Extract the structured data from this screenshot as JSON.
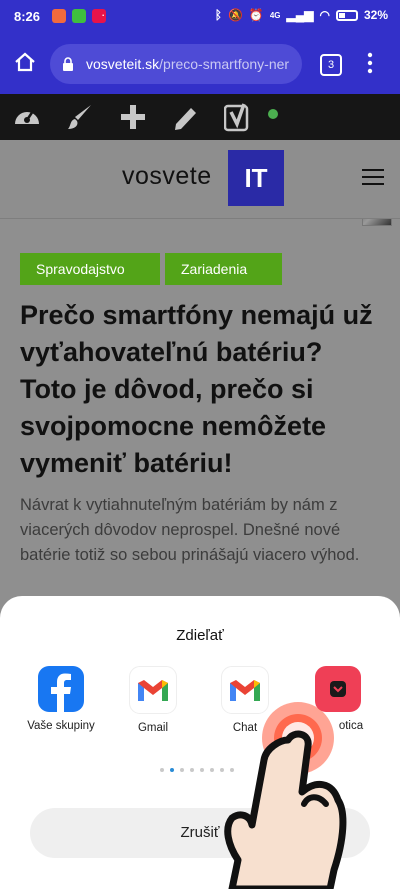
{
  "status": {
    "time": "8:26",
    "battery": "32",
    "network": "4G"
  },
  "browser": {
    "url_domain": "vosveteit.sk",
    "url_path": "/preco-smartfony-ner",
    "tab_count": "3"
  },
  "site": {
    "logo_text": "vosvete",
    "logo_box": "IT"
  },
  "article": {
    "tags": [
      "Spravodajstvo",
      "Zariadenia"
    ],
    "title": "Prečo smartfóny nemajú už vyťahovateľnú batériu? Toto je dôvod, prečo si svojpomocne nemôžete vymeniť batériu!",
    "lede": "Návrat k vytiahnuteľným batériám by nám z viacerých dôvodov neprospel. Dnešné nové batérie totiž so sebou prinášajú viacero výhod."
  },
  "share": {
    "title": "Zdieľať",
    "apps": [
      {
        "label": "Vaše skupiny",
        "icon": "facebook-icon"
      },
      {
        "label": "Gmail",
        "icon": "gmail-icon"
      },
      {
        "label": "Chat",
        "icon": "gmail-chat-icon"
      },
      {
        "label": "Pocket",
        "icon": "pocket-icon",
        "visible_label": "otica"
      }
    ],
    "cancel_label": "Zrušiť",
    "page_count": 8,
    "active_page": 1
  },
  "colors": {
    "browser": "#3330c9",
    "accent_green": "#53a418",
    "logo_blue": "#2a2aa6",
    "touch_indicator": "#ff5a3c"
  }
}
